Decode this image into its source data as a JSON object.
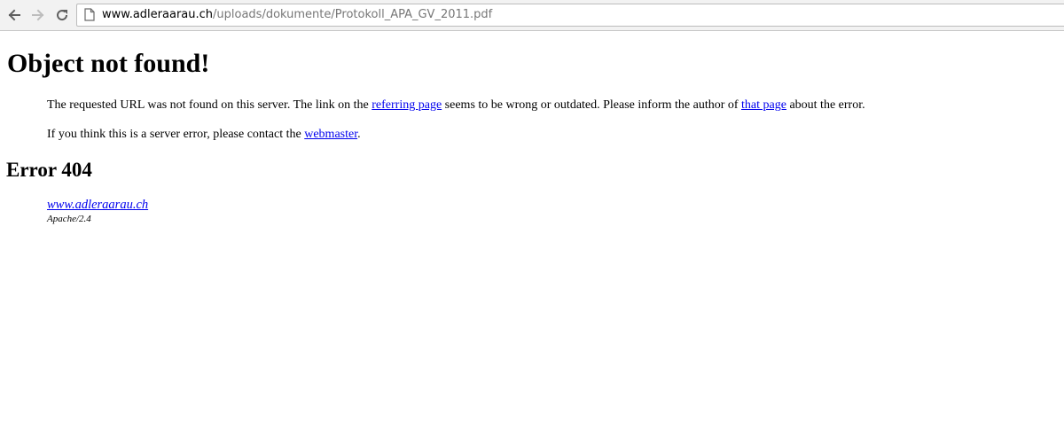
{
  "browser": {
    "url_host": "www.adleraarau.ch",
    "url_path": "/uploads/dokumente/Protokoll_APA_GV_2011.pdf",
    "icons": {
      "back": "back-arrow-icon",
      "forward": "forward-arrow-icon",
      "reload": "reload-icon",
      "page": "page-icon"
    }
  },
  "page": {
    "title": "Object not found!",
    "paragraph1": {
      "before_link1": "The requested URL was not found on this server. The link on the ",
      "link1": "referring page",
      "between": " seems to be wrong or outdated. Please inform the author of ",
      "link2": "that page",
      "after": " about the error."
    },
    "paragraph2": {
      "before_link": "If you think this is a server error, please contact the ",
      "link": "webmaster",
      "after": "."
    },
    "error_heading": "Error 404",
    "address": {
      "site_link": "www.adleraarau.ch",
      "server": "Apache/2.4"
    }
  },
  "colors": {
    "link": "#0000ee",
    "toolbar": "#f2f2f2",
    "url_path": "#777777"
  }
}
